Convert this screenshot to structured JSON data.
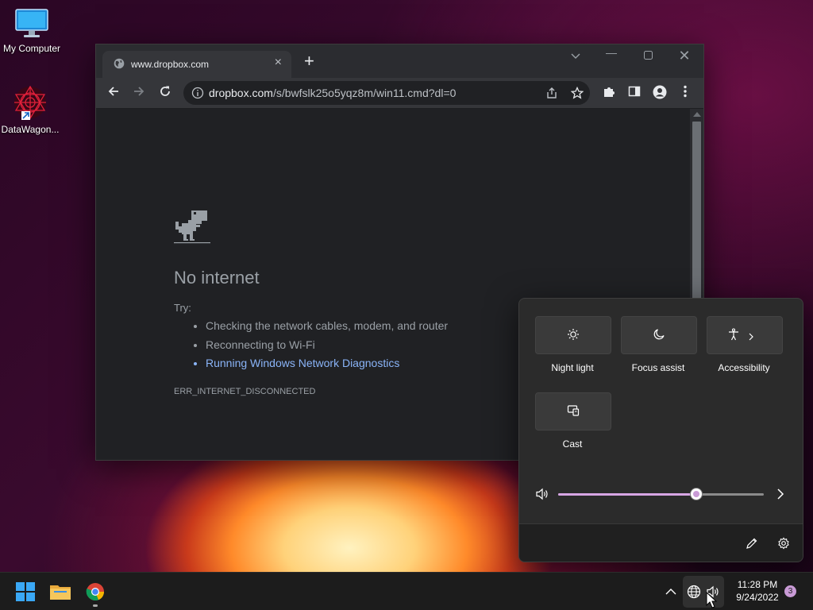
{
  "desktop": {
    "icons": [
      {
        "label": "My Computer",
        "icon": "monitor-icon"
      },
      {
        "label": "DataWagon...",
        "icon": "datawagon-logo-icon"
      }
    ]
  },
  "browser": {
    "tab": {
      "title": "www.dropbox.com",
      "favicon": "globe-icon"
    },
    "address": {
      "domain": "dropbox.com",
      "path": "/s/bwfslk25o5yqz8m/win11.cmd?dl=0"
    },
    "error_page": {
      "title": "No internet",
      "try_label": "Try:",
      "suggestions": [
        "Checking the network cables, modem, and router",
        "Reconnecting to Wi-Fi",
        "Running Windows Network Diagnostics"
      ],
      "code": "ERR_INTERNET_DISCONNECTED"
    }
  },
  "quick_settings": {
    "tiles": [
      {
        "label": "Night light",
        "icon": "brightness-icon"
      },
      {
        "label": "Focus assist",
        "icon": "moon-icon"
      },
      {
        "label": "Accessibility",
        "icon": "accessibility-icon"
      },
      {
        "label": "Cast",
        "icon": "cast-icon"
      }
    ],
    "volume": {
      "level": 0.67,
      "accent": "#d7a6e4"
    }
  },
  "taskbar": {
    "time": "11:28 PM",
    "date": "9/24/2022",
    "notifications": "3"
  }
}
